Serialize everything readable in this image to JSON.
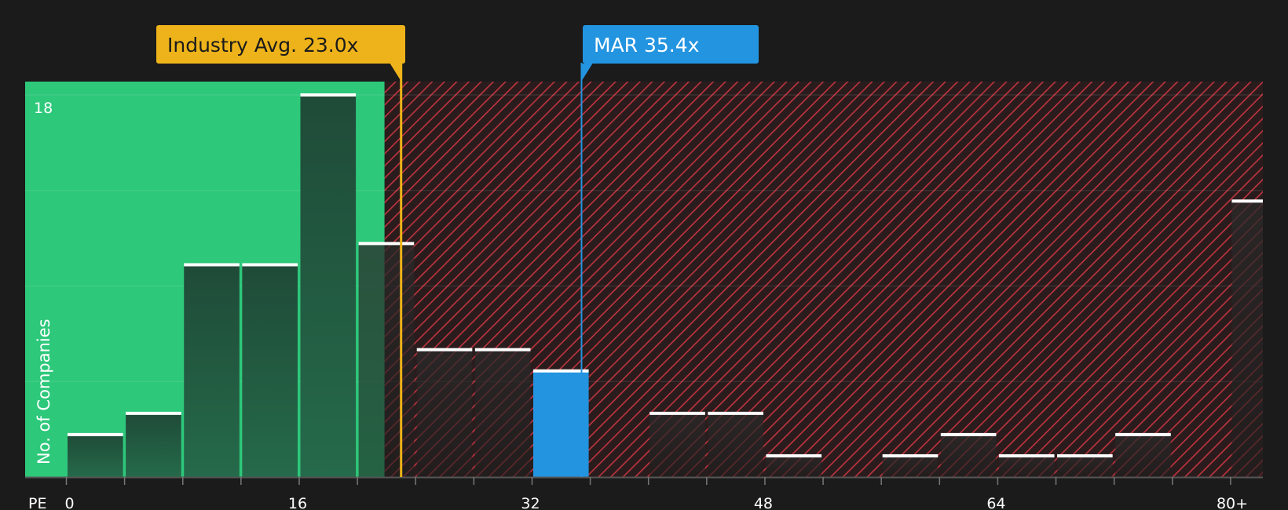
{
  "chart_data": {
    "type": "bar",
    "xlabel": "PE",
    "ylabel": "No. of Companies",
    "x_ticks": [
      "0",
      "16",
      "32",
      "48",
      "64",
      "80+"
    ],
    "y_ticks": [
      "18"
    ],
    "xlim": [
      0,
      80
    ],
    "ylim": [
      0,
      18.6
    ],
    "bin_width": 4,
    "bins": [
      {
        "x0": 0,
        "value": 2
      },
      {
        "x0": 4,
        "value": 3
      },
      {
        "x0": 8,
        "value": 10
      },
      {
        "x0": 12,
        "value": 10
      },
      {
        "x0": 16,
        "value": 18
      },
      {
        "x0": 20,
        "value": 11
      },
      {
        "x0": 24,
        "value": 6
      },
      {
        "x0": 28,
        "value": 6
      },
      {
        "x0": 32,
        "value": 5,
        "highlight": true
      },
      {
        "x0": 36,
        "value": 0
      },
      {
        "x0": 40,
        "value": 3
      },
      {
        "x0": 44,
        "value": 3
      },
      {
        "x0": 48,
        "value": 1
      },
      {
        "x0": 52,
        "value": 0
      },
      {
        "x0": 56,
        "value": 1
      },
      {
        "x0": 60,
        "value": 2
      },
      {
        "x0": 64,
        "value": 1
      },
      {
        "x0": 68,
        "value": 1
      },
      {
        "x0": 72,
        "value": 2
      },
      {
        "x0": 76,
        "value": 0
      },
      {
        "x0": 80,
        "value": 13
      }
    ],
    "annotations": [
      {
        "label": "Industry Avg. 23.0x",
        "x": 23.0,
        "color": "#eeb31a",
        "text_color": "#1b1b1b"
      },
      {
        "label": "MAR 35.4x",
        "x": 35.4,
        "color": "#2394e0",
        "text_color": "#ffffff"
      }
    ],
    "good_zone_color": "#2ec87b",
    "bad_zone_color": "#c0343f",
    "grid": true
  }
}
